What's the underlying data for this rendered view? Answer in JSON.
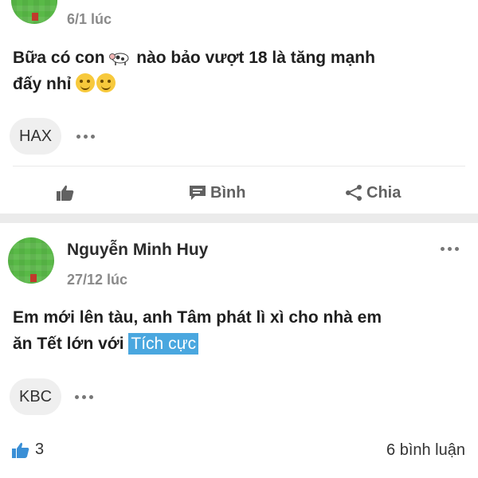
{
  "post1": {
    "time": "6/1 lúc",
    "content_before": "Bữa có con",
    "content_after": "nào bảo vượt 18 là tăng mạnh",
    "content_line2": "đấy nhỉ",
    "tag": "HAX",
    "actions": {
      "comment": "Bình",
      "share": "Chia"
    }
  },
  "post2": {
    "author": "Nguyễn Minh Huy",
    "time": "27/12 lúc",
    "content_line1": "Em mới lên tàu, anh Tâm phát lì xì cho nhà em",
    "content_line2": "ăn Tết lớn với",
    "sentiment": "Tích cực",
    "tag": "KBC",
    "like_count": "3",
    "comment_count": "6 bình luận"
  },
  "colors": {
    "accent": "#4aa7df",
    "avatar": "#59b947",
    "like": "#3a8fd6"
  },
  "icons": [
    "thumbs-up-icon",
    "comment-icon",
    "share-icon",
    "more-icon",
    "cow-emoji",
    "woozy-emoji"
  ]
}
